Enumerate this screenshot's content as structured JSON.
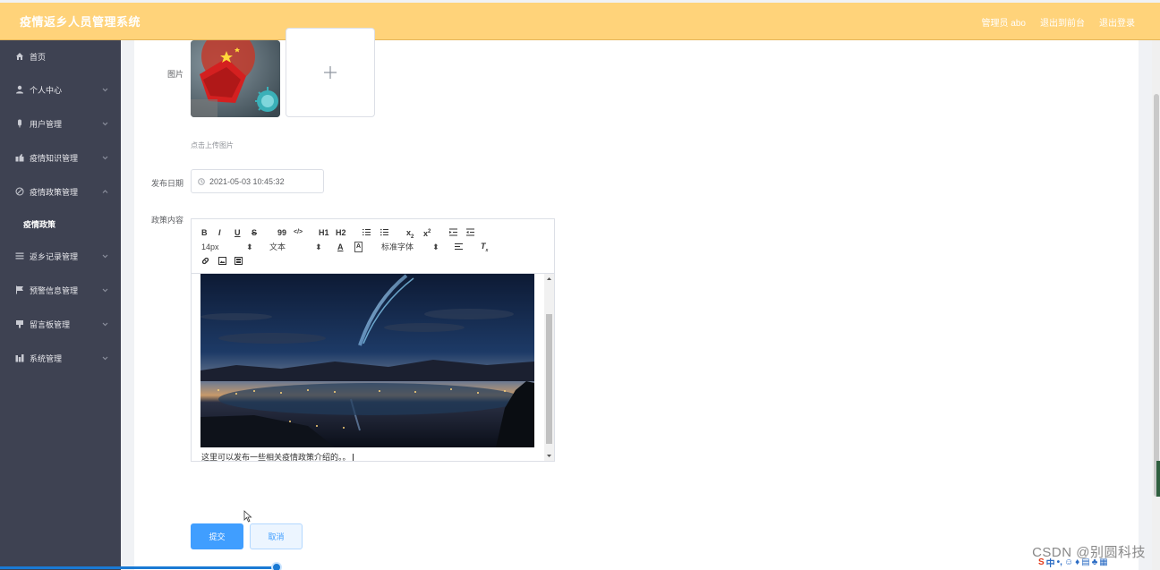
{
  "header": {
    "title": "疫情返乡人员管理系统",
    "user": "管理员 abo",
    "back_to_front": "退出到前台",
    "logout": "退出登录"
  },
  "sidebar": {
    "items": [
      {
        "label": "首页",
        "icon": "home-icon",
        "chevron": false
      },
      {
        "label": "个人中心",
        "icon": "user-icon",
        "chevron": true
      },
      {
        "label": "用户管理",
        "icon": "user-manage-icon",
        "chevron": true
      },
      {
        "label": "疫情知识管理",
        "icon": "book-icon",
        "chevron": true
      },
      {
        "label": "疫情政策管理",
        "icon": "policy-icon",
        "chevron": true,
        "expanded": true
      },
      {
        "label": "返乡记录管理",
        "icon": "list-icon",
        "chevron": true
      },
      {
        "label": "预警信息管理",
        "icon": "flag-icon",
        "chevron": true
      },
      {
        "label": "留言板管理",
        "icon": "message-icon",
        "chevron": true
      },
      {
        "label": "系统管理",
        "icon": "chart-icon",
        "chevron": true
      }
    ],
    "sub_item": "疫情政策"
  },
  "form": {
    "image_label": "图片",
    "upload_tip": "点击上传图片",
    "date_label": "发布日期",
    "date_value": "2021-05-03 10:45:32",
    "content_label": "政策内容",
    "content_text": "这里可以发布一些相关疫情政策介绍的。。",
    "submit_label": "提交",
    "cancel_label": "取消"
  },
  "editor": {
    "toolbar_row1": [
      "B",
      "I",
      "U",
      "S",
      "99",
      "</>",
      "H1",
      "H2",
      "ol",
      "ul",
      "x2",
      "x2",
      "indent",
      "outdent"
    ],
    "font_size": "14px",
    "text_style": "文本",
    "font_family": "标准字体"
  },
  "watermark": "CSDN @别圆科技",
  "colors": {
    "header": "#ffd37a",
    "sidebar": "#3e4252",
    "primary": "#409eff"
  }
}
